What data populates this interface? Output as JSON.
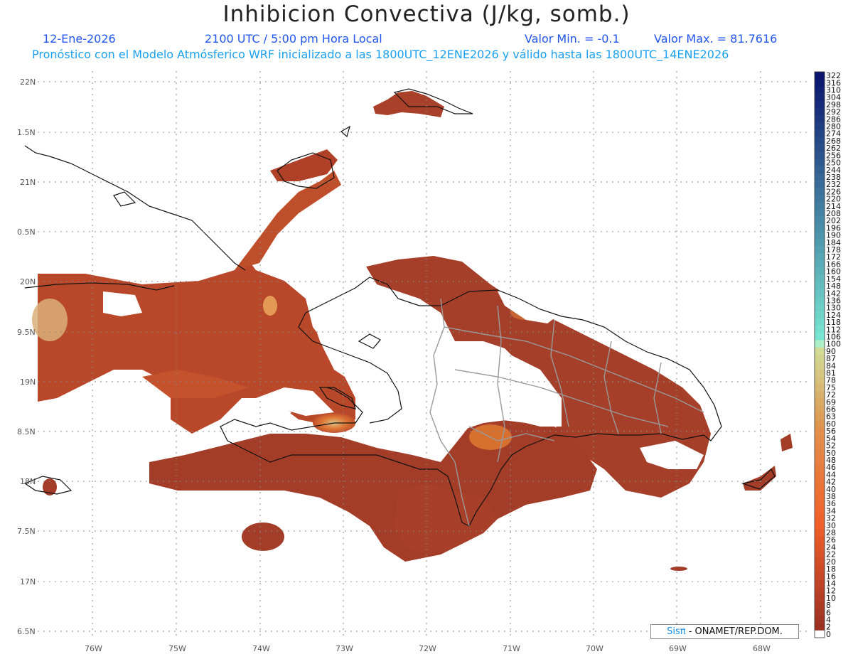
{
  "header": {
    "title": "Inhibicion Convectiva (J/kg, somb.)",
    "date": "12-Ene-2026",
    "time": "2100 UTC / 5:00 pm Hora Local",
    "valor_min": "Valor Min. = -0.1",
    "valor_max": "Valor Max. = 81.7616",
    "description": "Pronóstico con el Modelo Atmósferico WRF inicializado a las 1800UTC_12ENE2026 y válido hasta las  1800UTC_14ENE2026"
  },
  "axes": {
    "lat_labels": [
      "22N",
      "1.5N",
      "21N",
      "0.5N",
      "20N",
      "9.5N",
      "19N",
      "8.5N",
      "18N",
      "7.5N",
      "17N",
      "6.5N"
    ],
    "lon_labels": [
      "76W",
      "75W",
      "74W",
      "73W",
      "72W",
      "71W",
      "70W",
      "69W",
      "68W"
    ]
  },
  "colorbar": {
    "labels": [
      "322",
      "316",
      "310",
      "304",
      "298",
      "292",
      "286",
      "280",
      "274",
      "268",
      "262",
      "256",
      "250",
      "244",
      "238",
      "232",
      "226",
      "220",
      "214",
      "208",
      "202",
      "196",
      "190",
      "184",
      "178",
      "172",
      "166",
      "160",
      "154",
      "148",
      "142",
      "136",
      "130",
      "124",
      "118",
      "112",
      "106",
      "100",
      "90",
      "87",
      "84",
      "81",
      "78",
      "75",
      "72",
      "69",
      "66",
      "63",
      "60",
      "56",
      "54",
      "52",
      "50",
      "48",
      "46",
      "44",
      "42",
      "40",
      "38",
      "36",
      "34",
      "32",
      "30",
      "28",
      "26",
      "24",
      "22",
      "20",
      "18",
      "16",
      "14",
      "12",
      "10",
      "8",
      "6",
      "4",
      "2",
      "0"
    ]
  },
  "colors": {
    "low": "#9e3a22",
    "mid": "#c2502a",
    "high": "#e07a38",
    "peak": "#d8c890"
  },
  "credit": {
    "brand": "Sisπ",
    "text": " - ONAMET/REP.DOM."
  }
}
